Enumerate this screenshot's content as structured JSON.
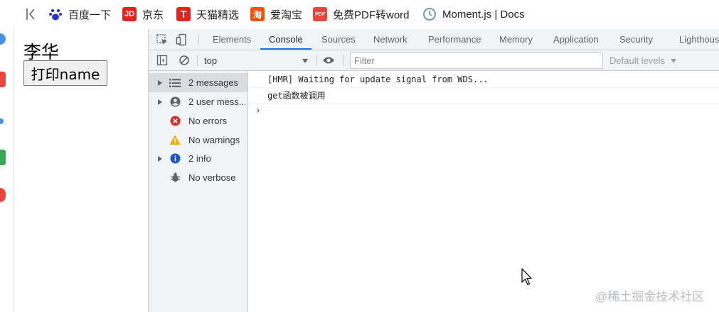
{
  "bookmarks": {
    "items": [
      {
        "label": "百度一下",
        "icon": "baidu-paw-icon",
        "color": "#2932e1"
      },
      {
        "label": "京东",
        "icon": "jd-logo-icon",
        "badge": "JD",
        "color": "#e1251b"
      },
      {
        "label": "天猫精选",
        "icon": "tmall-logo-icon",
        "badge": "T",
        "color": "#e1251b"
      },
      {
        "label": "爱淘宝",
        "icon": "taobao-logo-icon",
        "badge": "淘",
        "color": "#ff5000"
      },
      {
        "label": "免费PDF转word",
        "icon": "pdf-icon",
        "badge": "PDF",
        "color": "#e8453c"
      },
      {
        "label": "Moment.js | Docs",
        "icon": "clock-icon",
        "color": "#6b9e9a"
      }
    ]
  },
  "page": {
    "name": "李华",
    "button_label": "打印name"
  },
  "devtools": {
    "tabs": [
      "Elements",
      "Console",
      "Sources",
      "Network",
      "Performance",
      "Memory",
      "Application",
      "Security",
      "Lighthous"
    ],
    "active_tab": "Console",
    "context": "top",
    "filter_placeholder": "Filter",
    "levels_label": "Default levels",
    "sidebar": [
      {
        "label": "2 messages",
        "icon": "list-icon",
        "expandable": true,
        "selected": true
      },
      {
        "label": "2 user mess...",
        "icon": "user-icon",
        "expandable": true,
        "selected": false
      },
      {
        "label": "No errors",
        "icon": "error-icon",
        "expandable": false,
        "selected": false
      },
      {
        "label": "No warnings",
        "icon": "warning-icon",
        "expandable": false,
        "selected": false
      },
      {
        "label": "2 info",
        "icon": "info-icon",
        "expandable": true,
        "selected": false
      },
      {
        "label": "No verbose",
        "icon": "bug-icon",
        "expandable": false,
        "selected": false
      }
    ],
    "logs": [
      "[HMR] Waiting for update signal from WDS...",
      "get函数被调用"
    ],
    "accent_color": "#1a73e8"
  },
  "watermark": "@稀土掘金技术社区"
}
